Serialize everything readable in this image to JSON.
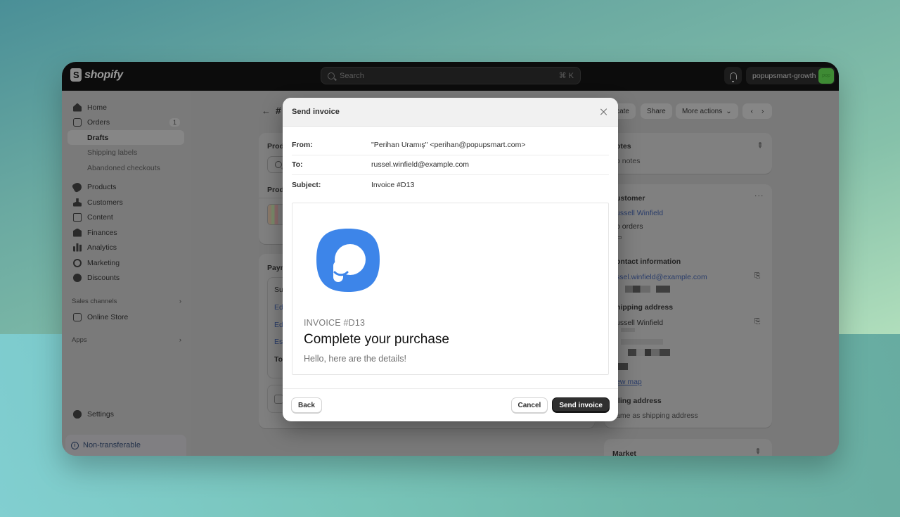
{
  "topbar": {
    "brand": "shopify",
    "search_placeholder": "Search",
    "search_shortcut": "⌘ K",
    "store_name": "popupsmart-growth",
    "store_avatar": "pop"
  },
  "sidebar": {
    "items": [
      {
        "label": "Home",
        "icon": "home-icon"
      },
      {
        "label": "Orders",
        "icon": "orders-icon",
        "badge": "1"
      },
      {
        "label": "Drafts"
      },
      {
        "label": "Shipping labels"
      },
      {
        "label": "Abandoned checkouts"
      },
      {
        "label": "Products",
        "icon": "tag-icon"
      },
      {
        "label": "Customers",
        "icon": "person-icon"
      },
      {
        "label": "Content",
        "icon": "content-icon"
      },
      {
        "label": "Finances",
        "icon": "bank-icon"
      },
      {
        "label": "Analytics",
        "icon": "bar-chart-icon"
      },
      {
        "label": "Marketing",
        "icon": "target-icon"
      },
      {
        "label": "Discounts",
        "icon": "discount-icon"
      }
    ],
    "sales_channels_label": "Sales channels",
    "online_store_label": "Online Store",
    "apps_label": "Apps",
    "settings_label": "Settings",
    "non_transferable_label": "Non-transferable"
  },
  "page": {
    "title_prefix": "#",
    "header_buttons": {
      "duplicate": "cate",
      "share": "Share",
      "more_actions": "More actions"
    },
    "products_card": {
      "heading": "Prod",
      "subheading": "Prod"
    },
    "payment_card": {
      "heading": "Paym",
      "rows": [
        "Su",
        "Ed",
        "Ed",
        "Es",
        "To"
      ]
    },
    "notes": {
      "heading": "otes",
      "value": "o notes"
    },
    "customer": {
      "heading": "ustomer",
      "name": "ussell Winfield",
      "orders": "o orders",
      "contact_heading": "ontact information",
      "email": "ssel.winfield@example.com",
      "shipping_heading": "hipping address",
      "shipping_name": "ussell Winfield",
      "view_map": "ew map",
      "billing_heading": "lling address",
      "billing_value": "ame as shipping address"
    },
    "market": {
      "heading": "Market"
    }
  },
  "modal": {
    "title": "Send invoice",
    "from_label": "From:",
    "from_value": "\"Perihan Uramış\" <perihan@popupsmart.com>",
    "to_label": "To:",
    "to_value": "russel.winfield@example.com",
    "subject_label": "Subject:",
    "subject_value": "Invoice #D13",
    "preview": {
      "brand_color": "#3d85e9",
      "invoice_label": "INVOICE #D13",
      "headline": "Complete your purchase",
      "subtext": "Hello, here are the details!"
    },
    "back_label": "Back",
    "cancel_label": "Cancel",
    "send_label": "Send invoice"
  }
}
